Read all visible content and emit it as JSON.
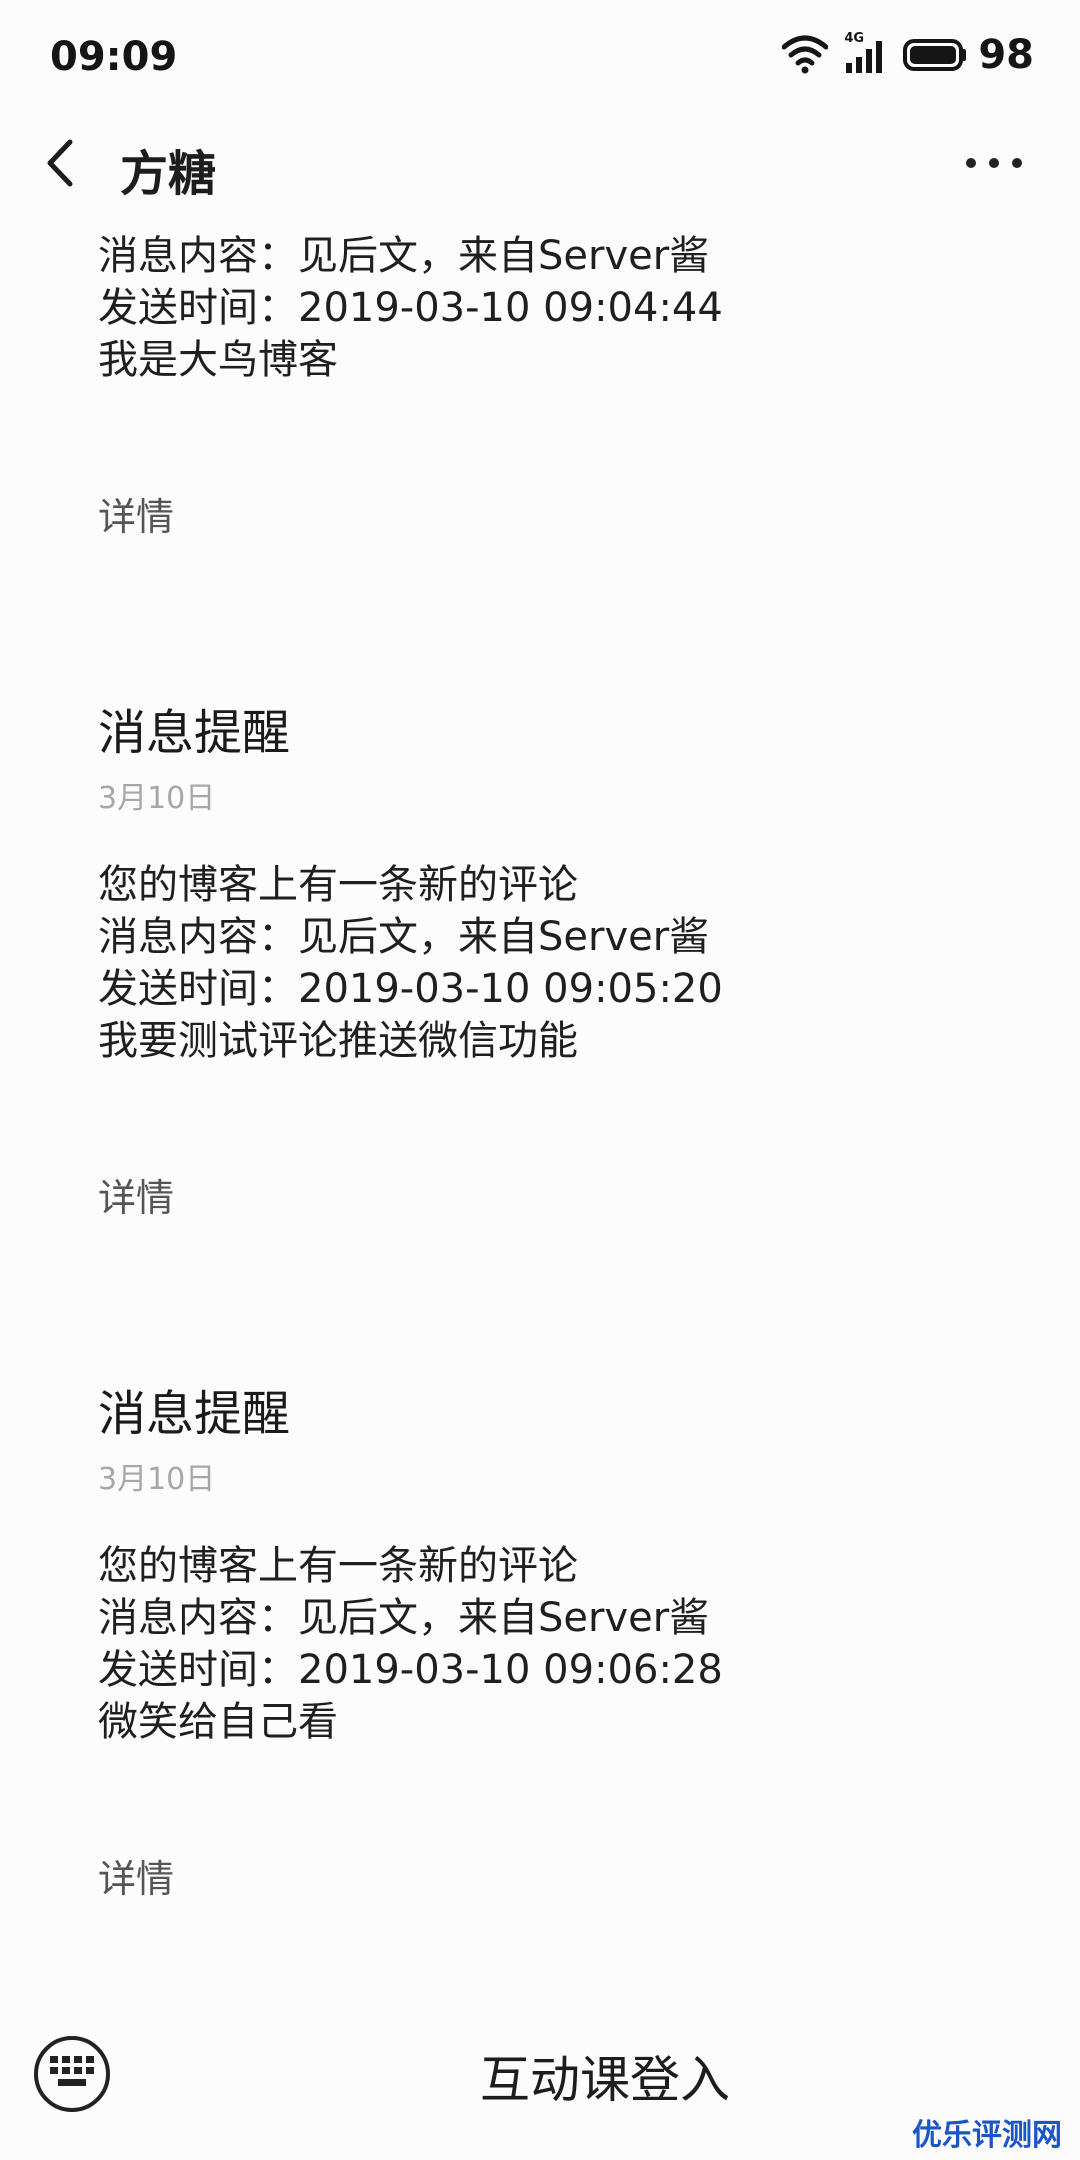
{
  "status_bar": {
    "time": "09:09",
    "network": "4G",
    "battery": "98"
  },
  "header": {
    "title": "方糖"
  },
  "first_message": {
    "lines": [
      "消息内容：见后文，来自Server酱",
      "发送时间：2019-03-10 09:04:44",
      "我是大鸟博客"
    ],
    "detail_label": "详情"
  },
  "cards": [
    {
      "title": "消息提醒",
      "date": "3月10日",
      "lines": [
        "您的博客上有一条新的评论",
        "消息内容：见后文，来自Server酱",
        "发送时间：2019-03-10 09:05:20",
        "我要测试评论推送微信功能"
      ],
      "detail_label": "详情"
    },
    {
      "title": "消息提醒",
      "date": "3月10日",
      "lines": [
        "您的博客上有一条新的评论",
        "消息内容：见后文，来自Server酱",
        "发送时间：2019-03-10 09:06:28",
        "微笑给自己看"
      ],
      "detail_label": "详情"
    }
  ],
  "bottom_bar": {
    "label": "互动课登入"
  },
  "watermark": "优乐评测网"
}
